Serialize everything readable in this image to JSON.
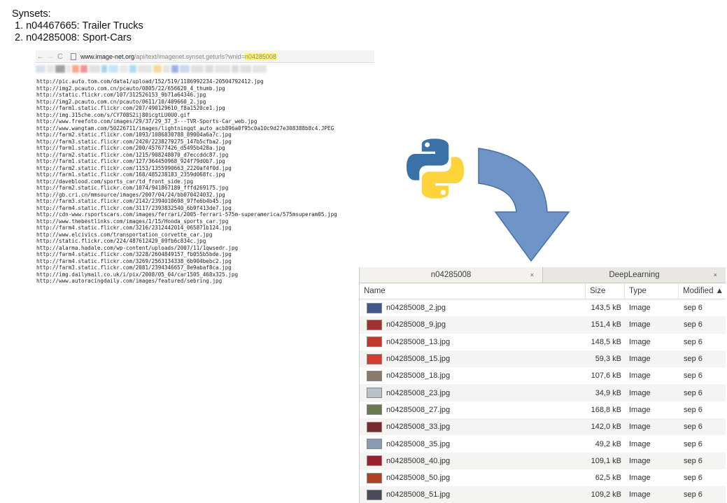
{
  "synsets": {
    "title": "Synsets:",
    "items": [
      "1. n04467665: Trailer Trucks",
      "2. n04285008: Sport-Cars"
    ]
  },
  "browser": {
    "back": "←",
    "forward": "→",
    "reload": "C",
    "url_host": "www.image-net.org",
    "url_path": "/api/text/imagenet.synset.geturls?wnid=",
    "url_highlight": "n04285008",
    "highlight_color": "#fff56b"
  },
  "urls": [
    "http://pic.auto.tom.com/data1/upload/152/519/1186992234-20504792412.jpg",
    "http://img2.pcauto.com.cn/pcauto/0805/22/656620_4_thumb.jpg",
    "http://static.flickr.com/107/312526153_9b71a64346.jpg",
    "http://img2.pcauto.com.cn/pcauto/0611/10/409660_2.jpg",
    "http://farm1.static.flickr.com/207/490129610_f8a1520ce1.jpg",
    "http://img.315che.com/s/CY708S2ij80icgtLU0U0.gif",
    "http://www.freefoto.com/images/29/37/29_37_3---TVR-Sports-Car_web.jpg",
    "http://www.wangtam.com/50226711/images/lightningqt_auto_acb896a0f95c0a10c9d27e308388b8c4.JPEG",
    "http://farm2.static.flickr.com/1093/1086830788_89004a6a7c.jpg",
    "http://farm3.static.flickr.com/2420/2238279275_147b5cfba2.jpg",
    "http://farm1.static.flickr.com/200/457677426_d5495b428a.jpg",
    "http://farm2.static.flickr.com/1215/908248070_d7eccddc87.jpg",
    "http://farm1.static.flickr.com/127/364450968_924f79d0b7.jpg",
    "http://farm2.static.flickr.com/1153/1355990663_2220af4f0d.jpg",
    "http://farm1.static.flickr.com/168/485238183_2359d068fc.jpg",
    "http://daveblood.com/sports_car/td_front_side.jpg",
    "http://farm2.static.flickr.com/1074/941867189_fffd269175.jpg",
    "http://gb.cri.cn/mmsource/images/2007/04/24/bb070424032.jpg",
    "http://farm3.static.flickr.com/2142/2394010698_97fe6b4b45.jpg",
    "http://farm4.static.flickr.com/3117/2393832540_6b9f413de7.jpg",
    "http://cdn-www.rsportscars.com/images/ferrari/2005-ferrari-575m-superamerica/575msuperam05.jpg",
    "http://www.thebestlinks.com/images/1/15/Honda_sports_car.jpg",
    "http://farm4.static.flickr.com/3216/2312442014_065871b124.jpg",
    "http://www.elcivics.com/transportation_corvette_car.jpg",
    "http://static.flickr.com/224/487612429_09fb6c834c.jpg",
    "http://alarma.hadale.com/wp-content/uploads/2007/11/1qwsedr.jpg",
    "http://farm4.static.flickr.com/3228/2604849157_fb055b5bde.jpg",
    "http://farm4.static.flickr.com/3269/2563134338_6b904bebc2.jpg",
    "http://farm3.static.flickr.com/2081/2394346657_8e9abaf8ca.jpg",
    "http://img.dailymail.co.uk/i/pix/2008/05_04/car1505_468x325.jpg",
    "http://www.autoracingdaily.com/images/featured/sebring.jpg"
  ],
  "file_manager": {
    "tabs": [
      {
        "label": "n04285008",
        "close": "×"
      },
      {
        "label": "DeepLearning",
        "close": "×"
      }
    ],
    "columns": {
      "name": "Name",
      "size": "Size",
      "type": "Type",
      "modified": "Modified ▲"
    },
    "files": [
      {
        "name": "n04285008_2.jpg",
        "size": "143,5 kB",
        "type": "Image",
        "modified": "sep 6",
        "thumb_color": "#3f5a8a"
      },
      {
        "name": "n04285008_9.jpg",
        "size": "151,4 kB",
        "type": "Image",
        "modified": "sep 6",
        "thumb_color": "#a33030"
      },
      {
        "name": "n04285008_13.jpg",
        "size": "148,5 kB",
        "type": "Image",
        "modified": "sep 6",
        "thumb_color": "#c23a2a"
      },
      {
        "name": "n04285008_15.jpg",
        "size": "59,3 kB",
        "type": "Image",
        "modified": "sep 6",
        "thumb_color": "#d9382c"
      },
      {
        "name": "n04285008_18.jpg",
        "size": "107,6 kB",
        "type": "Image",
        "modified": "sep 6",
        "thumb_color": "#8a7a6a"
      },
      {
        "name": "n04285008_23.jpg",
        "size": "34,9 kB",
        "type": "Image",
        "modified": "sep 6",
        "thumb_color": "#b9c0c8"
      },
      {
        "name": "n04285008_27.jpg",
        "size": "168,8 kB",
        "type": "Image",
        "modified": "sep 6",
        "thumb_color": "#6a7a4a"
      },
      {
        "name": "n04285008_33.jpg",
        "size": "142,0 kB",
        "type": "Image",
        "modified": "sep 6",
        "thumb_color": "#7a2a2a"
      },
      {
        "name": "n04285008_35.jpg",
        "size": "49,2 kB",
        "type": "Image",
        "modified": "sep 6",
        "thumb_color": "#8a9ab0"
      },
      {
        "name": "n04285008_40.jpg",
        "size": "109,1 kB",
        "type": "Image",
        "modified": "sep 6",
        "thumb_color": "#9a2030"
      },
      {
        "name": "n04285008_50.jpg",
        "size": "62,5 kB",
        "type": "Image",
        "modified": "sep 6",
        "thumb_color": "#b04020"
      },
      {
        "name": "n04285008_51.jpg",
        "size": "109,2 kB",
        "type": "Image",
        "modified": "sep 6",
        "thumb_color": "#4a4a5a"
      }
    ]
  },
  "colors": {
    "python_blue": "#3a72a8",
    "python_yellow": "#ffd43b",
    "arrow_fill": "#6f94c8",
    "arrow_stroke": "#4a6fa5"
  }
}
